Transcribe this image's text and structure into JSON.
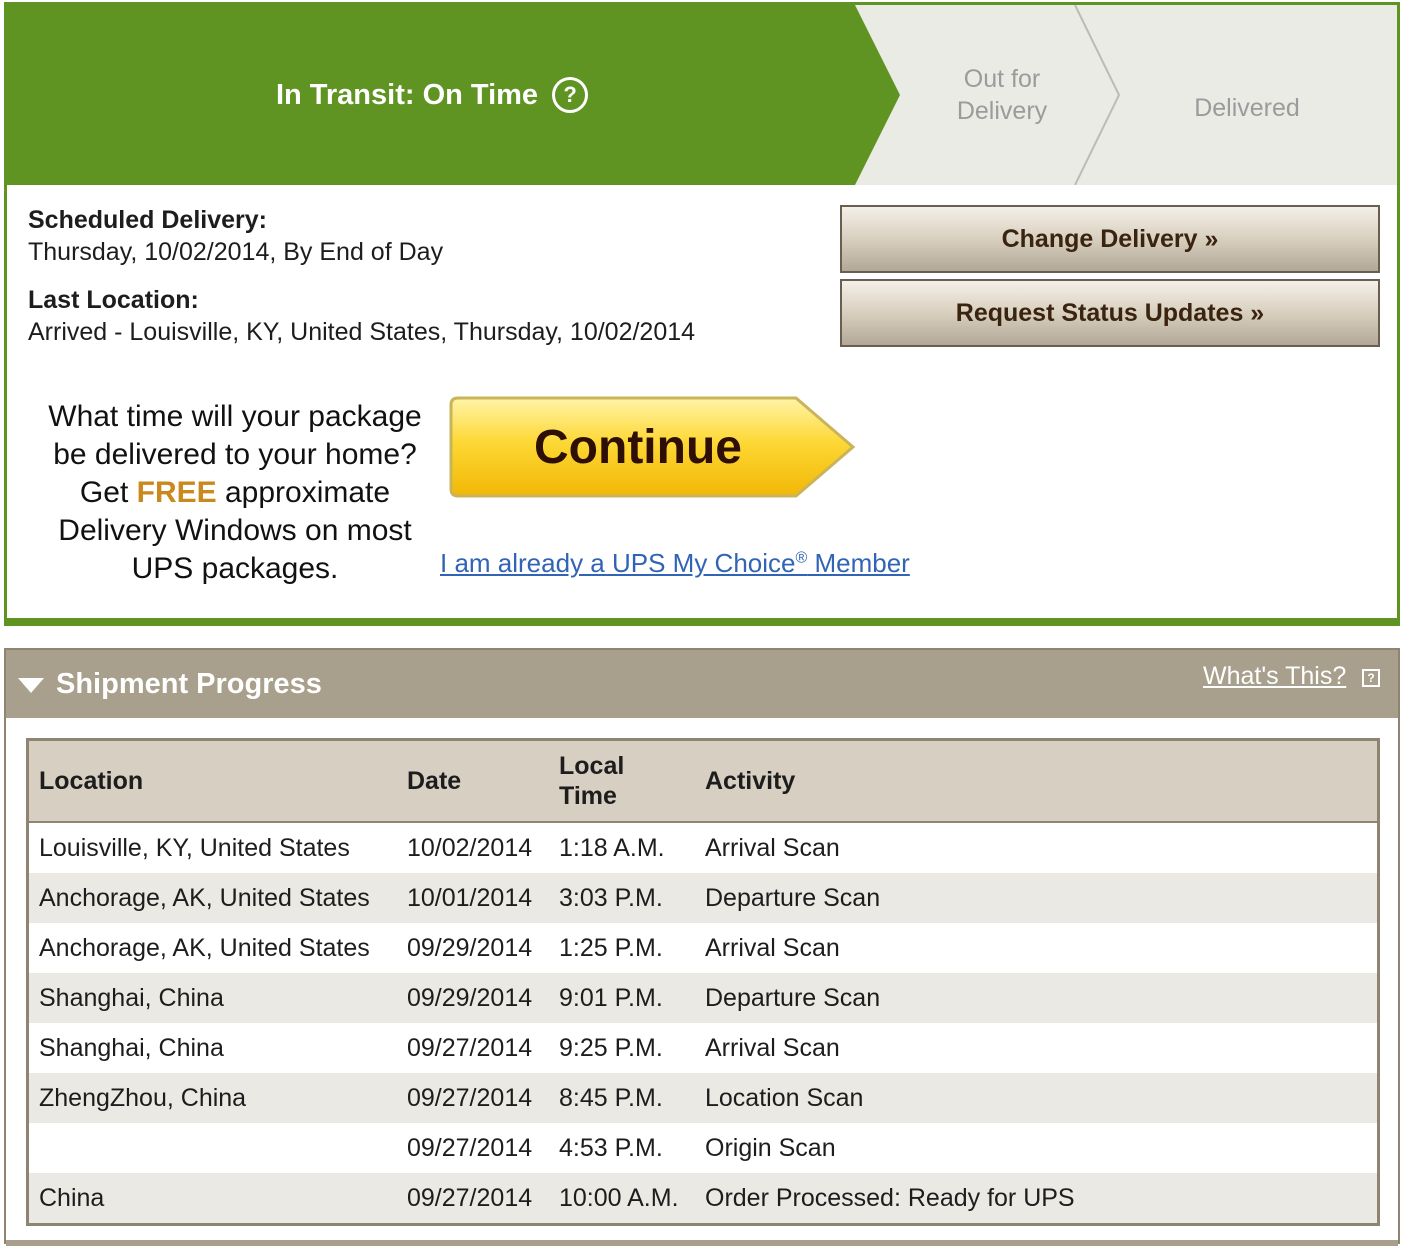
{
  "status": {
    "current_stage": "In Transit: On Time",
    "help_icon": "?",
    "stages": [
      "Out for Delivery",
      "Delivered"
    ],
    "stage_out_line1": "Out for",
    "stage_out_line2": "Delivery",
    "stage_delivered": "Delivered",
    "colors": {
      "current": "#5f9423",
      "inactive": "#ebebe6"
    }
  },
  "details": {
    "scheduled_label": "Scheduled Delivery:",
    "scheduled_value": "Thursday, 10/02/2014, By End of Day",
    "last_location_label": "Last Location:",
    "last_location_value": "Arrived - Louisville, KY, United States, Thursday, 10/02/2014"
  },
  "actions": {
    "change_delivery": "Change Delivery »",
    "request_updates": "Request Status Updates »"
  },
  "promo": {
    "line1": "What time will your package",
    "line2": "be delivered to your home?",
    "get": "Get",
    "free": "FREE",
    "approx": "approximate",
    "line4": "Delivery Windows on most",
    "line5": "UPS packages.",
    "continue_label": "Continue",
    "member_link_pre": "I am already a UPS My Choice",
    "member_link_reg": "®",
    "member_link_post": " Member"
  },
  "shipment": {
    "title": "Shipment Progress",
    "whats_this": "What's This?",
    "columns": {
      "location": "Location",
      "date": "Date",
      "local_time_1": "Local",
      "local_time_2": "Time",
      "activity": "Activity"
    },
    "rows": [
      {
        "location": "Louisville, KY, United States",
        "date": "10/02/2014",
        "time": "1:18 A.M.",
        "activity": "Arrival Scan"
      },
      {
        "location": "Anchorage, AK, United States",
        "date": "10/01/2014",
        "time": "3:03 P.M.",
        "activity": "Departure Scan"
      },
      {
        "location": "Anchorage, AK, United States",
        "date": "09/29/2014",
        "time": "1:25 P.M.",
        "activity": "Arrival Scan"
      },
      {
        "location": "Shanghai, China",
        "date": "09/29/2014",
        "time": "9:01 P.M.",
        "activity": "Departure Scan"
      },
      {
        "location": "Shanghai, China",
        "date": "09/27/2014",
        "time": "9:25 P.M.",
        "activity": "Arrival Scan"
      },
      {
        "location": "ZhengZhou, China",
        "date": "09/27/2014",
        "time": "8:45 P.M.",
        "activity": "Location Scan"
      },
      {
        "location": "",
        "date": "09/27/2014",
        "time": "4:53 P.M.",
        "activity": "Origin Scan"
      },
      {
        "location": "China",
        "date": "09/27/2014",
        "time": "10:00 A.M.",
        "activity": "Order Processed: Ready for UPS"
      }
    ]
  }
}
